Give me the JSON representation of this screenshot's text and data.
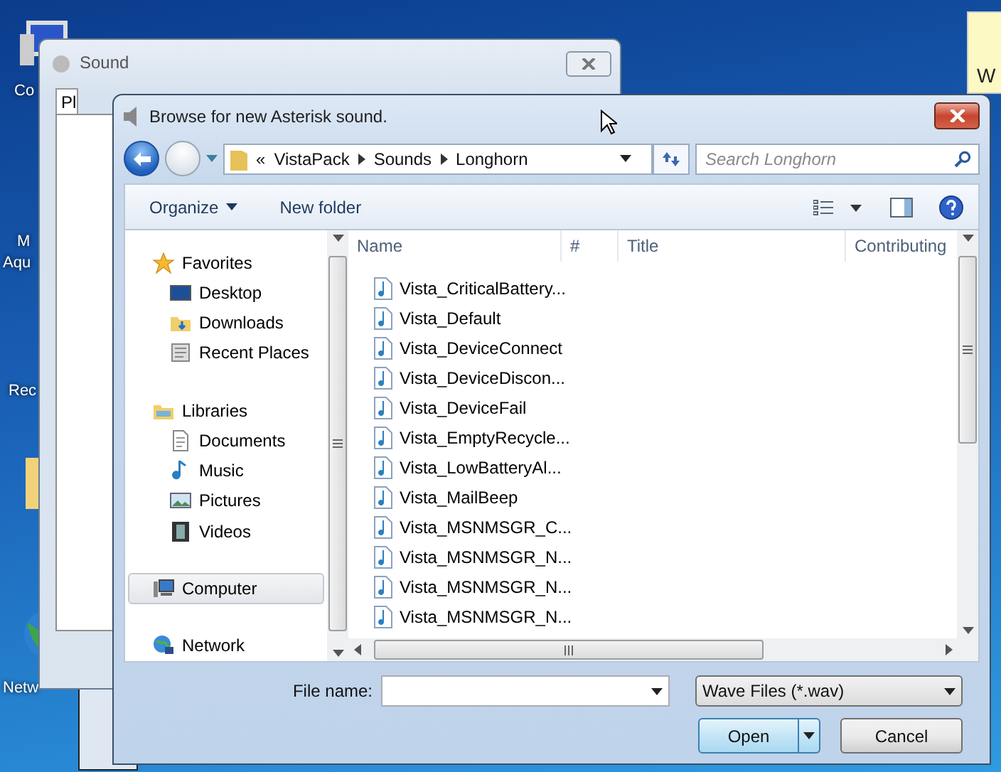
{
  "desktop": {
    "icons": [
      {
        "label": "Co"
      },
      {
        "label": "M"
      },
      {
        "label": "Aqu"
      },
      {
        "label": "Rec"
      },
      {
        "label": "Netw"
      }
    ],
    "note": {
      "text": "W"
    }
  },
  "sound_window": {
    "title": "Sound",
    "tab": "Pl"
  },
  "dialog": {
    "title": "Browse for new Asterisk sound.",
    "breadcrumb": [
      "«",
      "VistaPack",
      "Sounds",
      "Longhorn"
    ],
    "search": {
      "placeholder": "Search Longhorn"
    },
    "toolbar": [
      {
        "label": "Organize",
        "kind": "menu"
      },
      {
        "label": "New folder",
        "kind": "plain"
      }
    ],
    "nav": [
      {
        "label": "Favorites",
        "kind": "favorites",
        "selected": false,
        "children": [
          {
            "label": "Desktop",
            "kind": "desktop",
            "selected": false
          },
          {
            "label": "Downloads",
            "kind": "downloads",
            "selected": false
          },
          {
            "label": "Recent Places",
            "kind": "recent",
            "selected": false
          }
        ]
      },
      {
        "label": "Libraries",
        "kind": "libraries",
        "selected": false,
        "children": [
          {
            "label": "Documents",
            "kind": "documents",
            "selected": false
          },
          {
            "label": "Music",
            "kind": "music",
            "selected": false
          },
          {
            "label": "Pictures",
            "kind": "pictures",
            "selected": false
          },
          {
            "label": "Videos",
            "kind": "videos",
            "selected": false
          }
        ]
      },
      {
        "label": "Computer",
        "kind": "computer",
        "selected": true
      },
      {
        "label": "Network",
        "kind": "network",
        "selected": false
      }
    ],
    "columns": [
      "Name",
      "#",
      "Title",
      "Contributing"
    ],
    "files": [
      "Vista_CriticalBattery...",
      "Vista_Default",
      "Vista_DeviceConnect",
      "Vista_DeviceDiscon...",
      "Vista_DeviceFail",
      "Vista_EmptyRecycle...",
      "Vista_LowBatteryAl...",
      "Vista_MailBeep",
      "Vista_MSNMSGR_C...",
      "Vista_MSNMSGR_N...",
      "Vista_MSNMSGR_N...",
      "Vista_MSNMSGR_N..."
    ],
    "file_name": {
      "label": "File name:"
    },
    "filter": {
      "value": "Wave Files (*.wav)"
    },
    "buttons": [
      {
        "label": "Open",
        "kind": "split",
        "default": true
      },
      {
        "label": "Cancel",
        "kind": "plain",
        "default": false
      }
    ]
  }
}
